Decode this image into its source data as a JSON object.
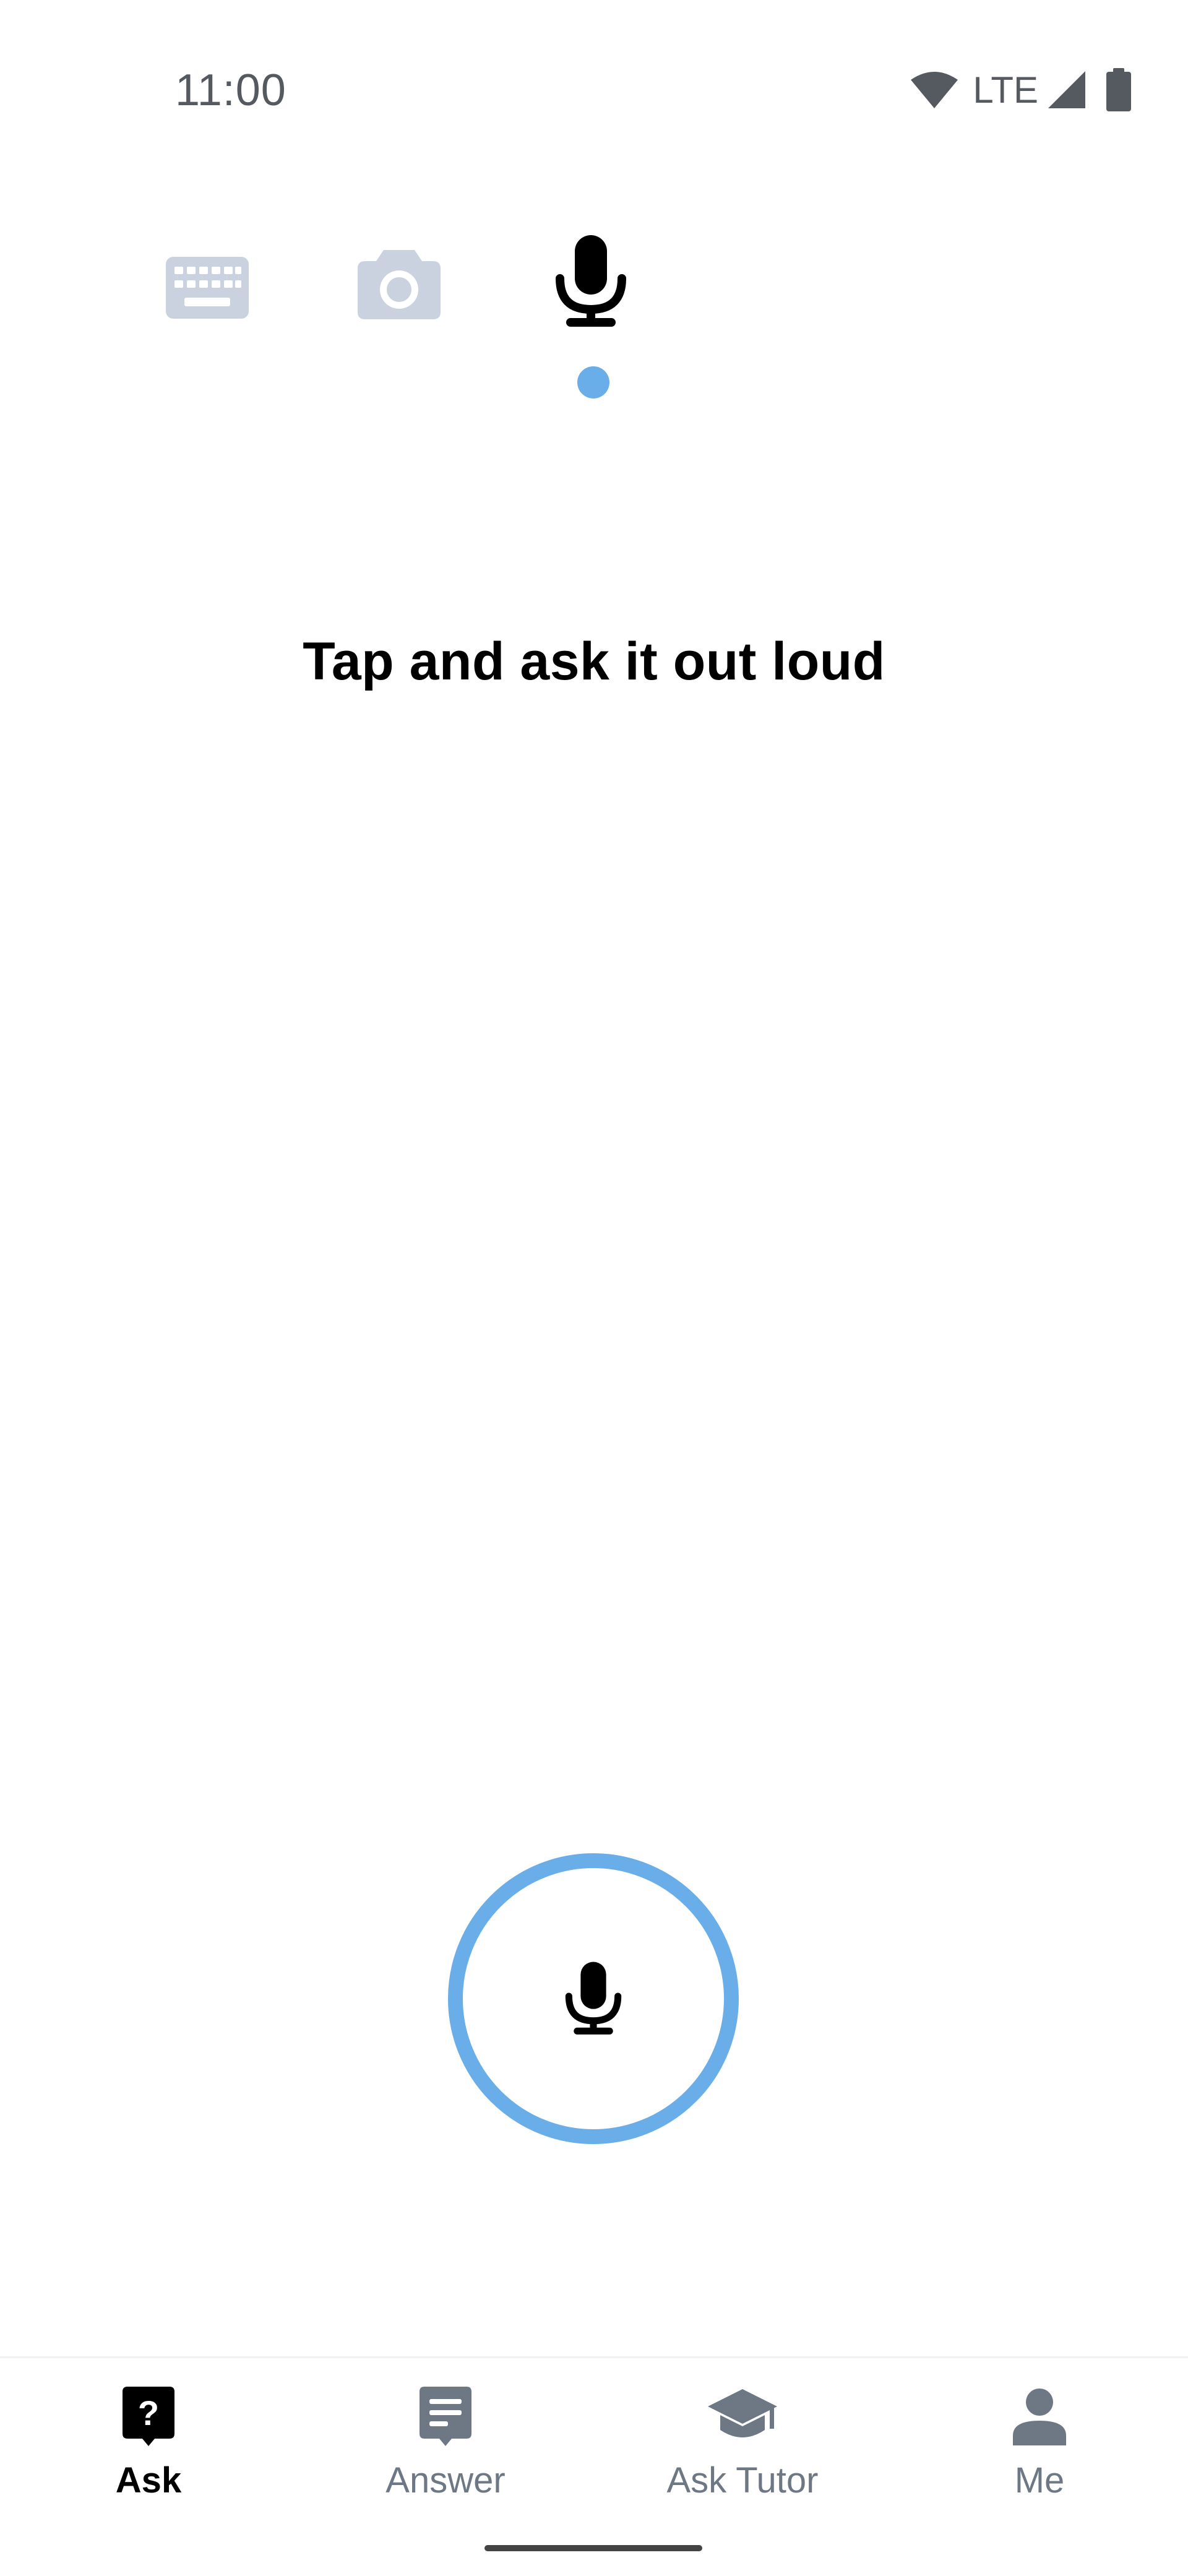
{
  "status_bar": {
    "time": "11:00",
    "network": "LTE",
    "icons": [
      "wifi-icon",
      "cell-signal-icon",
      "battery-icon"
    ]
  },
  "mode_tabs": {
    "items": [
      {
        "name": "keyboard",
        "icon": "keyboard-icon",
        "active": false
      },
      {
        "name": "camera",
        "icon": "camera-icon",
        "active": false
      },
      {
        "name": "voice",
        "icon": "microphone-icon",
        "active": true
      }
    ],
    "inactive_color": "#c9d2de",
    "active_color": "#000000",
    "indicator_color": "#6aaee9"
  },
  "prompt": {
    "text": "Tap and ask it out loud"
  },
  "record_button": {
    "icon": "microphone-icon",
    "ring_color": "#6aaee9"
  },
  "bottom_nav": {
    "items": [
      {
        "label": "Ask",
        "icon": "question-bubble-icon",
        "active": true
      },
      {
        "label": "Answer",
        "icon": "answer-bubble-icon",
        "active": false
      },
      {
        "label": "Ask Tutor",
        "icon": "graduation-cap-icon",
        "active": false
      },
      {
        "label": "Me",
        "icon": "person-icon",
        "active": false
      }
    ],
    "active_color": "#000000",
    "inactive_color": "#6d7884"
  }
}
